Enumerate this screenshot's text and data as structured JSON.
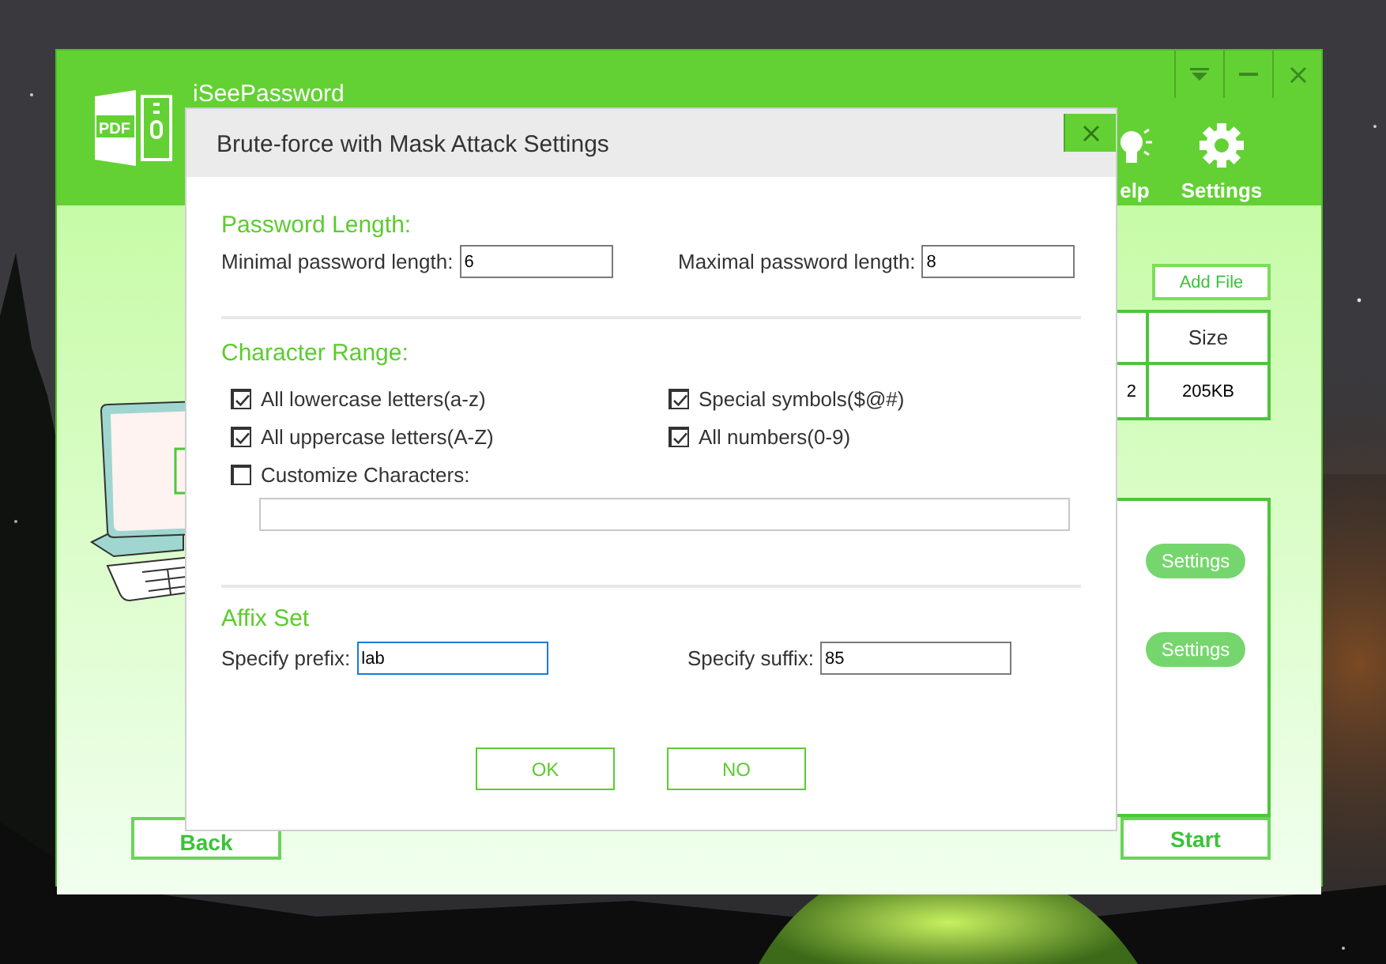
{
  "app": {
    "logo_text": "PDF",
    "name": "iSeePassword",
    "toolbar": [
      {
        "kind": "help",
        "label": "elp"
      },
      {
        "kind": "settings",
        "label": "Settings"
      }
    ],
    "add_file_button": "Add File",
    "table": {
      "columns": [
        "",
        "Size"
      ],
      "rows": [
        [
          "2",
          "205KB"
        ]
      ]
    },
    "attack_settings_buttons": [
      "Settings",
      "Settings"
    ],
    "back_button": "Back",
    "start_button": "Start"
  },
  "dialog": {
    "title": "Brute-force with Mask Attack Settings",
    "password_length": {
      "heading": "Password Length:",
      "fields": [
        {
          "label": "Minimal password length:",
          "value": "6",
          "focused": false
        },
        {
          "label": "Maximal password length:",
          "value": "8",
          "focused": false
        }
      ]
    },
    "character_range": {
      "heading": "Character Range:",
      "options": [
        {
          "label": "All lowercase letters(a-z)",
          "checked": true
        },
        {
          "label": "Special symbols($@#)",
          "checked": true
        },
        {
          "label": "All uppercase letters(A-Z)",
          "checked": true
        },
        {
          "label": "All numbers(0-9)",
          "checked": true
        },
        {
          "label": "Customize Characters:",
          "checked": false
        }
      ]
    },
    "affix": {
      "heading": "Affix Set",
      "fields": [
        {
          "label": "Specify prefix:",
          "value": "lab",
          "focused": true
        },
        {
          "label": "Specify suffix:",
          "value": "85",
          "focused": false
        }
      ]
    },
    "buttons": [
      "OK",
      "NO"
    ]
  }
}
